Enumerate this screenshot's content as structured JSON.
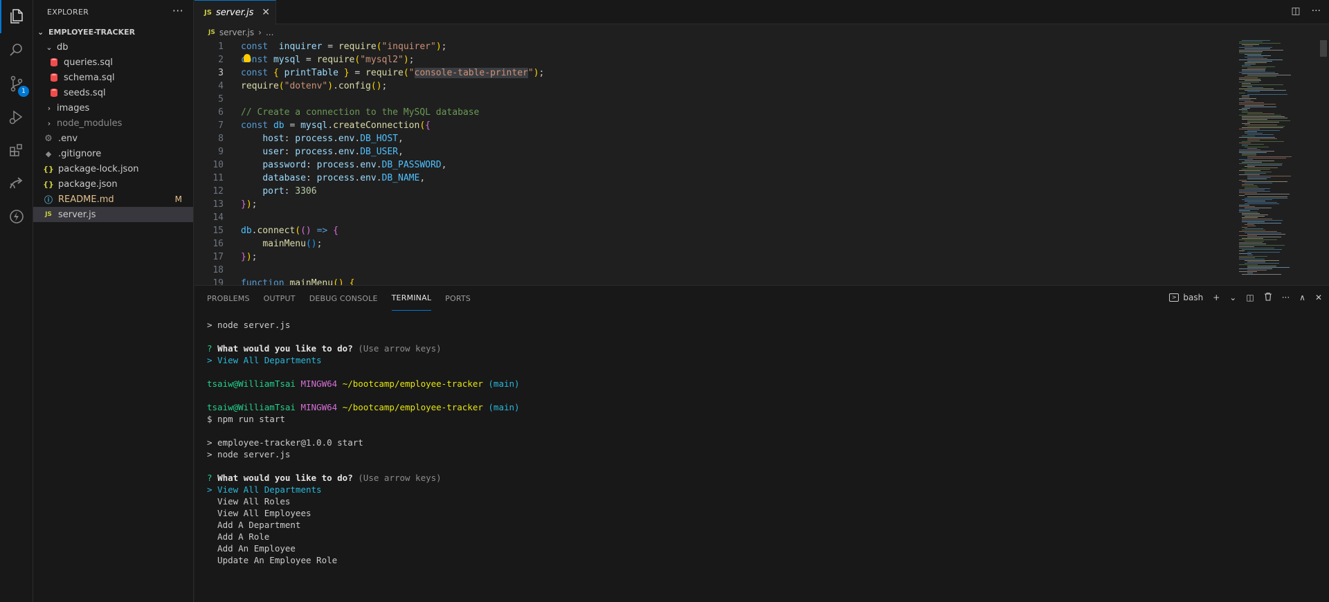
{
  "activity_bar": {
    "items": [
      {
        "icon": "files-icon",
        "active": true
      },
      {
        "icon": "search-icon"
      },
      {
        "icon": "source-control-icon",
        "badge": "1"
      },
      {
        "icon": "run-debug-icon"
      },
      {
        "icon": "extensions-icon"
      },
      {
        "icon": "remote-explorer-icon"
      },
      {
        "icon": "thunder-client-icon"
      }
    ]
  },
  "sidebar": {
    "title": "EXPLORER",
    "more": "···",
    "project": "EMPLOYEE-TRACKER",
    "tree": [
      {
        "label": "db",
        "kind": "folder-open",
        "depth": 0
      },
      {
        "label": "queries.sql",
        "kind": "sql",
        "depth": 1
      },
      {
        "label": "schema.sql",
        "kind": "sql",
        "depth": 1
      },
      {
        "label": "seeds.sql",
        "kind": "sql",
        "depth": 1
      },
      {
        "label": "images",
        "kind": "folder",
        "depth": 0
      },
      {
        "label": "node_modules",
        "kind": "folder-dim",
        "depth": 0
      },
      {
        "label": ".env",
        "kind": "env",
        "depth": 0
      },
      {
        "label": ".gitignore",
        "kind": "git",
        "depth": 0
      },
      {
        "label": "package-lock.json",
        "kind": "json",
        "depth": 0
      },
      {
        "label": "package.json",
        "kind": "json",
        "depth": 0
      },
      {
        "label": "README.md",
        "kind": "md",
        "depth": 0,
        "status": "M"
      },
      {
        "label": "server.js",
        "kind": "js",
        "depth": 0,
        "selected": true
      }
    ]
  },
  "editor": {
    "tab": {
      "lang": "JS",
      "name": "server.js",
      "close": "✕"
    },
    "breadcrumb": {
      "lang": "JS",
      "file": "server.js",
      "sep": "›",
      "rest": "..."
    },
    "lines": [
      {
        "n": "1",
        "tokens": [
          [
            "kw",
            "const"
          ],
          [
            "",
            "  "
          ],
          [
            "var",
            "inquirer"
          ],
          [
            "",
            " = "
          ],
          [
            "fn",
            "require"
          ],
          [
            "br1",
            "("
          ],
          [
            "str",
            "\"inquirer\""
          ],
          [
            "br1",
            ")"
          ],
          [
            "",
            ";"
          ]
        ]
      },
      {
        "n": "2",
        "tokens": [
          [
            "kw",
            "const"
          ],
          [
            "",
            " "
          ],
          [
            "var",
            "mysql"
          ],
          [
            "",
            " = "
          ],
          [
            "fn",
            "require"
          ],
          [
            "br1",
            "("
          ],
          [
            "str",
            "\"mysql2\""
          ],
          [
            "br1",
            ")"
          ],
          [
            "",
            ";"
          ]
        ]
      },
      {
        "n": "3",
        "cur": true,
        "tokens": [
          [
            "kw",
            "const"
          ],
          [
            "",
            " "
          ],
          [
            "br1",
            "{"
          ],
          [
            "",
            " "
          ],
          [
            "var",
            "printTable"
          ],
          [
            "",
            " "
          ],
          [
            "br1",
            "}"
          ],
          [
            "",
            " = "
          ],
          [
            "fn",
            "require"
          ],
          [
            "br1",
            "("
          ],
          [
            "str",
            "\""
          ],
          [
            "strhl",
            "console-table-printer"
          ],
          [
            "str",
            "\""
          ],
          [
            "br1",
            ")"
          ],
          [
            "",
            ";"
          ]
        ]
      },
      {
        "n": "4",
        "tokens": [
          [
            "fn",
            "require"
          ],
          [
            "br1",
            "("
          ],
          [
            "str",
            "\"dotenv\""
          ],
          [
            "br1",
            ")"
          ],
          [
            "",
            "."
          ],
          [
            "fn",
            "config"
          ],
          [
            "br1",
            "()"
          ],
          [
            "",
            ";"
          ]
        ]
      },
      {
        "n": "5",
        "tokens": []
      },
      {
        "n": "6",
        "tokens": [
          [
            "cmt",
            "// Create a connection to the MySQL database"
          ]
        ]
      },
      {
        "n": "7",
        "tokens": [
          [
            "kw",
            "const"
          ],
          [
            "",
            " "
          ],
          [
            "const",
            "db"
          ],
          [
            "",
            " = "
          ],
          [
            "var",
            "mysql"
          ],
          [
            "",
            "."
          ],
          [
            "fn",
            "createConnection"
          ],
          [
            "br1",
            "("
          ],
          [
            "br2",
            "{"
          ]
        ]
      },
      {
        "n": "8",
        "tokens": [
          [
            "",
            "    "
          ],
          [
            "var",
            "host"
          ],
          [
            "",
            ": "
          ],
          [
            "var",
            "process"
          ],
          [
            "",
            "."
          ],
          [
            "var",
            "env"
          ],
          [
            "",
            "."
          ],
          [
            "const",
            "DB_HOST"
          ],
          [
            "",
            ","
          ]
        ]
      },
      {
        "n": "9",
        "tokens": [
          [
            "",
            "    "
          ],
          [
            "var",
            "user"
          ],
          [
            "",
            ": "
          ],
          [
            "var",
            "process"
          ],
          [
            "",
            "."
          ],
          [
            "var",
            "env"
          ],
          [
            "",
            "."
          ],
          [
            "const",
            "DB_USER"
          ],
          [
            "",
            ","
          ]
        ]
      },
      {
        "n": "10",
        "tokens": [
          [
            "",
            "    "
          ],
          [
            "var",
            "password"
          ],
          [
            "",
            ": "
          ],
          [
            "var",
            "process"
          ],
          [
            "",
            "."
          ],
          [
            "var",
            "env"
          ],
          [
            "",
            "."
          ],
          [
            "const",
            "DB_PASSWORD"
          ],
          [
            "",
            ","
          ]
        ]
      },
      {
        "n": "11",
        "tokens": [
          [
            "",
            "    "
          ],
          [
            "var",
            "database"
          ],
          [
            "",
            ": "
          ],
          [
            "var",
            "process"
          ],
          [
            "",
            "."
          ],
          [
            "var",
            "env"
          ],
          [
            "",
            "."
          ],
          [
            "const",
            "DB_NAME"
          ],
          [
            "",
            ","
          ]
        ]
      },
      {
        "n": "12",
        "tokens": [
          [
            "",
            "    "
          ],
          [
            "var",
            "port"
          ],
          [
            "",
            ": "
          ],
          [
            "num",
            "3306"
          ]
        ]
      },
      {
        "n": "13",
        "tokens": [
          [
            "br2",
            "}"
          ],
          [
            "br1",
            ")"
          ],
          [
            "",
            ";"
          ]
        ]
      },
      {
        "n": "14",
        "tokens": []
      },
      {
        "n": "15",
        "tokens": [
          [
            "const",
            "db"
          ],
          [
            "",
            "."
          ],
          [
            "fn",
            "connect"
          ],
          [
            "br1",
            "("
          ],
          [
            "br2",
            "()"
          ],
          [
            "",
            " "
          ],
          [
            "kw",
            "=>"
          ],
          [
            "",
            " "
          ],
          [
            "br2",
            "{"
          ]
        ]
      },
      {
        "n": "16",
        "tokens": [
          [
            "",
            "    "
          ],
          [
            "fn",
            "mainMenu"
          ],
          [
            "br3",
            "()"
          ],
          [
            "",
            ";"
          ]
        ]
      },
      {
        "n": "17",
        "tokens": [
          [
            "br2",
            "}"
          ],
          [
            "br1",
            ")"
          ],
          [
            "",
            ";"
          ]
        ]
      },
      {
        "n": "18",
        "tokens": []
      },
      {
        "n": "19",
        "tokens": [
          [
            "kw",
            "function"
          ],
          [
            "",
            " "
          ],
          [
            "fn",
            "mainMenu"
          ],
          [
            "br1",
            "()"
          ],
          [
            "",
            " "
          ],
          [
            "br1",
            "{"
          ]
        ]
      }
    ]
  },
  "panel": {
    "tabs": [
      "PROBLEMS",
      "OUTPUT",
      "DEBUG CONSOLE",
      "TERMINAL",
      "PORTS"
    ],
    "active_tab": "TERMINAL",
    "shell": "bash",
    "actions": [
      "+",
      "⌄",
      "◫",
      "🗑",
      "···",
      "∧",
      "✕"
    ]
  },
  "terminal": {
    "lines": [
      [
        [
          "",
          "> node server.js"
        ]
      ],
      [],
      [
        [
          "t-green",
          "? "
        ],
        [
          "t-bold",
          "What would you like to do? "
        ],
        [
          "t-gray",
          "(Use arrow keys)"
        ]
      ],
      [
        [
          "t-cyan",
          "> View All Departments"
        ]
      ],
      [],
      [
        [
          "t-green",
          "tsaiw@WilliamTsai "
        ],
        [
          "t-mag",
          "MINGW64 "
        ],
        [
          "t-yel",
          "~/bootcamp/employee-tracker "
        ],
        [
          "t-cyan",
          "(main)"
        ]
      ],
      [],
      [
        [
          "t-green",
          "tsaiw@WilliamTsai "
        ],
        [
          "t-mag",
          "MINGW64 "
        ],
        [
          "t-yel",
          "~/bootcamp/employee-tracker "
        ],
        [
          "t-cyan",
          "(main)"
        ]
      ],
      [
        [
          "",
          "$ npm run start"
        ]
      ],
      [],
      [
        [
          "",
          "> employee-tracker@1.0.0 start"
        ]
      ],
      [
        [
          "",
          "> node server.js"
        ]
      ],
      [],
      [
        [
          "t-green",
          "? "
        ],
        [
          "t-bold",
          "What would you like to do? "
        ],
        [
          "t-gray",
          "(Use arrow keys)"
        ]
      ],
      [
        [
          "t-cyan",
          "> View All Departments"
        ]
      ],
      [
        [
          "",
          "  View All Roles"
        ]
      ],
      [
        [
          "",
          "  View All Employees"
        ]
      ],
      [
        [
          "",
          "  Add A Department"
        ]
      ],
      [
        [
          "",
          "  Add A Role"
        ]
      ],
      [
        [
          "",
          "  Add An Employee"
        ]
      ],
      [
        [
          "",
          "  Update An Employee Role"
        ]
      ]
    ]
  }
}
